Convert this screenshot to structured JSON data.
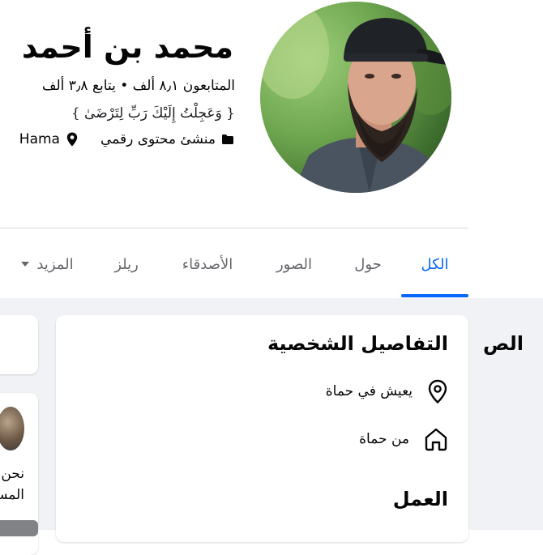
{
  "profile": {
    "name": "محمد بن أحمد",
    "followers_line": "المتابعون ٨٫١ ألف • يتابع ٣٫٨ ألف",
    "bio": "{ وَعَجِلْتُ إِلَيْكَ رَبِّ لِتَرْضَىٰ }",
    "category": "منشئ محتوى رقمي",
    "location": "Hama"
  },
  "tabs": [
    {
      "label": "الكل",
      "active": true
    },
    {
      "label": "حول",
      "active": false
    },
    {
      "label": "الصور",
      "active": false
    },
    {
      "label": "الأصدقاء",
      "active": false
    },
    {
      "label": "ريلز",
      "active": false
    },
    {
      "label": "المزيد",
      "active": false
    }
  ],
  "details": {
    "title": "التفاصيل الشخصية",
    "lives_in": "يعيش في حماة",
    "from": "من حماة",
    "work_title": "العمل"
  },
  "left_panel": {
    "card_title": "الص",
    "line1": "نحن",
    "line2": "المس"
  },
  "colors": {
    "accent": "#0866ff",
    "muted_text": "#65676b",
    "page_bg": "#f0f2f5"
  }
}
